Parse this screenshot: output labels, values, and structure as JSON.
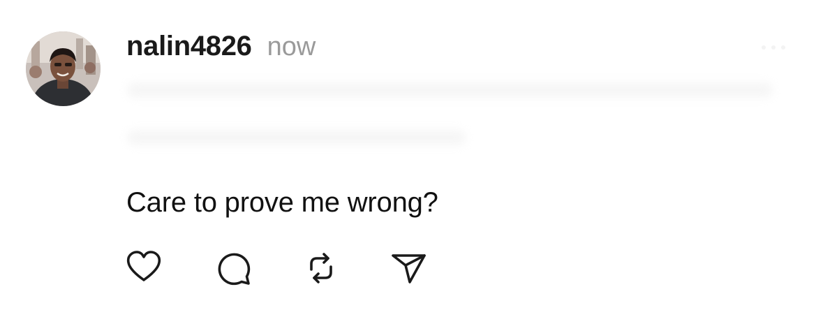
{
  "post": {
    "username": "nalin4826",
    "timestamp": "now",
    "text": "Care to prove me wrong?",
    "avatar": "avatar-photo",
    "icons": {
      "like": "heart-icon",
      "reply": "comment-icon",
      "repost": "repost-icon",
      "share": "send-icon",
      "more": "more-icon"
    }
  }
}
